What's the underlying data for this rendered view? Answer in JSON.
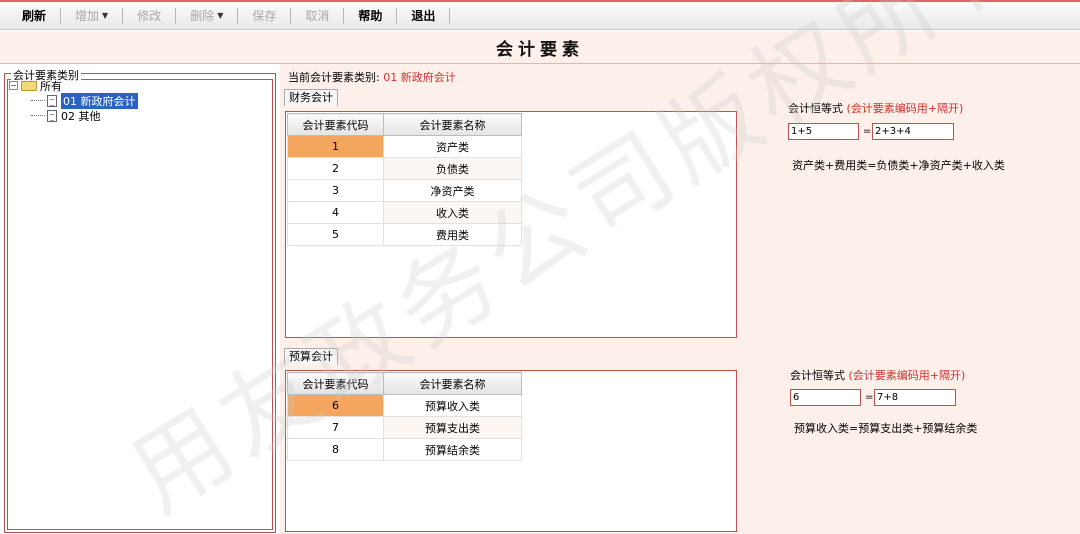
{
  "toolbar": {
    "refresh": "刷新",
    "add": "增加",
    "modify": "修改",
    "delete": "删除",
    "save": "保存",
    "cancel": "取消",
    "help": "帮助",
    "exit": "退出"
  },
  "page_title": "会计要素",
  "left": {
    "legend": "会计要素类别",
    "tree": {
      "root": "所有",
      "items": [
        "01 新政府会计",
        "02 其他"
      ]
    }
  },
  "current_category": {
    "label": "当前会计要素类别:",
    "value": "01 新政府会计"
  },
  "finance": {
    "tab": "财务会计",
    "headers": [
      "会计要素代码",
      "会计要素名称"
    ],
    "rows": [
      {
        "code": "1",
        "name": "资产类"
      },
      {
        "code": "2",
        "name": "负债类"
      },
      {
        "code": "3",
        "name": "净资产类"
      },
      {
        "code": "4",
        "name": "收入类"
      },
      {
        "code": "5",
        "name": "费用类"
      }
    ],
    "eq_label": "会计恒等式",
    "eq_hint": "(会计要素编码用+隔开)",
    "left_value": "1+5",
    "equals": "=",
    "right_value": "2+3+4",
    "formula": "资产类+费用类=负债类+净资产类+收入类"
  },
  "budget": {
    "tab": "预算会计",
    "headers": [
      "会计要素代码",
      "会计要素名称"
    ],
    "rows": [
      {
        "code": "6",
        "name": "预算收入类"
      },
      {
        "code": "7",
        "name": "预算支出类"
      },
      {
        "code": "8",
        "name": "预算结余类"
      }
    ],
    "eq_label": "会计恒等式",
    "eq_hint": "(会计要素编码用+隔开)",
    "left_value": "6",
    "equals": "=",
    "right_value": "7+8",
    "formula": "预算收入类=预算支出类+预算结余类"
  },
  "watermark": "用友政务公司版权所有",
  "colors": {
    "accent": "#c05050",
    "selected_row": "#f4a55e",
    "hint": "#d23030"
  }
}
